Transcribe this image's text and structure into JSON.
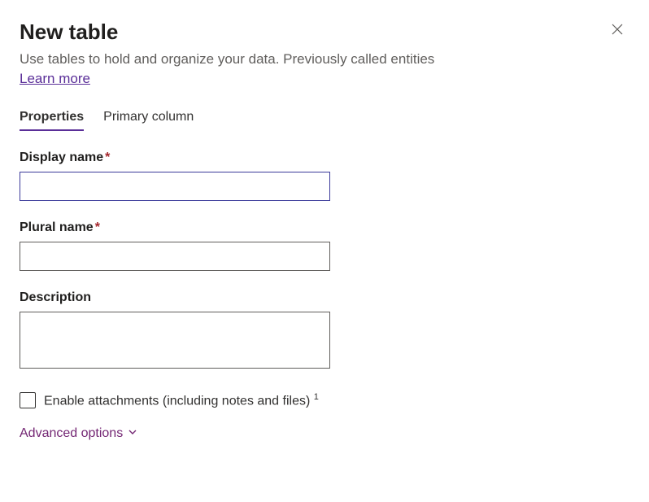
{
  "header": {
    "title": "New table",
    "subtitle": "Use tables to hold and organize your data. Previously called entities",
    "learn_more": "Learn more"
  },
  "tabs": [
    {
      "label": "Properties",
      "active": true
    },
    {
      "label": "Primary column",
      "active": false
    }
  ],
  "form": {
    "display_name": {
      "label": "Display name",
      "required": true,
      "value": ""
    },
    "plural_name": {
      "label": "Plural name",
      "required": true,
      "value": ""
    },
    "description": {
      "label": "Description",
      "required": false,
      "value": ""
    },
    "enable_attachments": {
      "label": "Enable attachments (including notes and files)",
      "footnote": "1",
      "checked": false
    }
  },
  "advanced": {
    "label": "Advanced options"
  }
}
